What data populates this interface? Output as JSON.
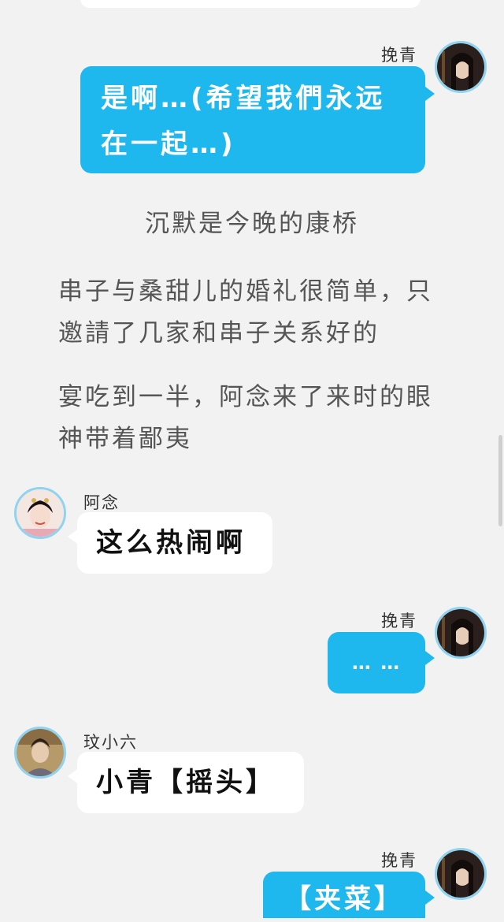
{
  "chat": {
    "msg1": {
      "sender": "挽青",
      "text": "是啊…(希望我們永远在一起…)"
    },
    "narration": [
      "沉默是今晚的康桥",
      "串子与桑甜儿的婚礼很简单，只邀請了几家和串子关系好的",
      "宴吃到一半，阿念来了来时的眼神带着鄙夷"
    ],
    "msg2": {
      "sender": "阿念",
      "text": "这么热闹啊"
    },
    "msg3": {
      "sender": "挽青",
      "text": "… …"
    },
    "msg4": {
      "sender": "玟小六",
      "text": "小青【摇头】"
    },
    "msg5": {
      "sender": "挽青",
      "text": "【夹菜】"
    }
  },
  "colors": {
    "right_bubble": "#1fb8ee",
    "left_bubble": "#ffffff",
    "background": "#f2f2f2",
    "avatar_ring": "#8ed3f0"
  },
  "icons": {
    "wanqing_avatar": "avatar-wanqing",
    "anian_avatar": "avatar-anian",
    "wenxiaoliu_avatar": "avatar-wenxiaoliu"
  }
}
